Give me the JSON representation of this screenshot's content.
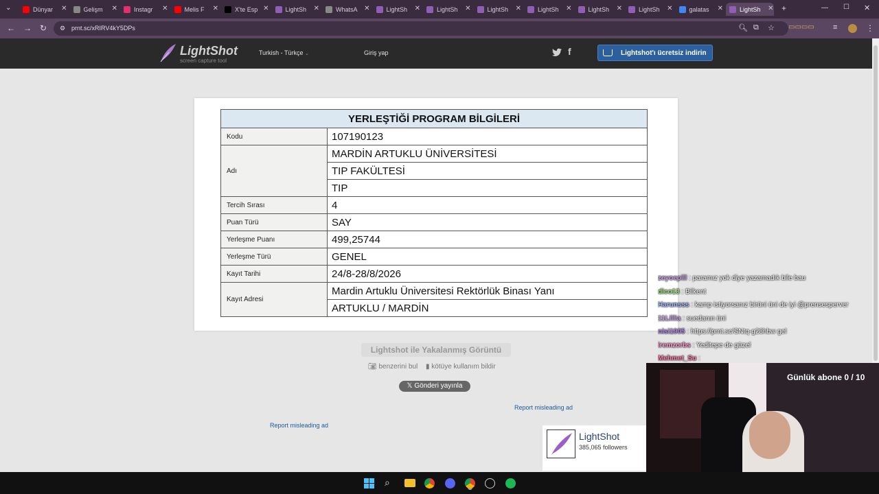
{
  "browser": {
    "tabs": [
      {
        "label": "Dünyar",
        "icon": "youtube-icon",
        "color": "#ff0000"
      },
      {
        "label": "Gelişm",
        "icon": "globe-icon",
        "color": "#888888"
      },
      {
        "label": "Instagr",
        "icon": "instagram-icon",
        "color": "#e1306c"
      },
      {
        "label": "Melis F",
        "icon": "youtube-icon",
        "color": "#ff0000"
      },
      {
        "label": "X'te Esp",
        "icon": "x-icon",
        "color": "#000000"
      },
      {
        "label": "LightSh",
        "icon": "lightshot-icon",
        "color": "#8e5fb5"
      },
      {
        "label": "WhatsA",
        "icon": "whatsapp-icon",
        "color": "#888888"
      },
      {
        "label": "LightSh",
        "icon": "lightshot-icon",
        "color": "#8e5fb5"
      },
      {
        "label": "LightSh",
        "icon": "lightshot-icon",
        "color": "#8e5fb5"
      },
      {
        "label": "LightSh",
        "icon": "lightshot-icon",
        "color": "#8e5fb5"
      },
      {
        "label": "LightSh",
        "icon": "lightshot-icon",
        "color": "#8e5fb5"
      },
      {
        "label": "LightSh",
        "icon": "lightshot-icon",
        "color": "#8e5fb5"
      },
      {
        "label": "LightSh",
        "icon": "lightshot-icon",
        "color": "#8e5fb5"
      },
      {
        "label": "galatas",
        "icon": "google-icon",
        "color": "#4285f4"
      },
      {
        "label": "LightSh",
        "icon": "lightshot-icon",
        "color": "#8e5fb5",
        "active": true
      }
    ],
    "url": "prnt.sc/xRIRV4kY5DPs"
  },
  "lightshot": {
    "logo_title": "LightShot",
    "logo_subtitle": "screen capture tool",
    "language": "Turkish - Türkçe",
    "login": "Giriş yap",
    "download_label": "Lightshot'ı ücretsiz indirin",
    "caption": "Lightshot ile Yakalanmış Görüntü",
    "find_similar": "benzerini bul",
    "report_abuse": "kötüye kullanım bildir",
    "tweet_label": "Gönderi yayınla",
    "report_ad_1": "Report misleading ad",
    "report_ad_2": "Report misleading ad",
    "ad_title": "LightShot",
    "ad_followers": "385,065 followers"
  },
  "document": {
    "heading": "YERLEŞTİĞİ PROGRAM BİLGİLERİ",
    "rows": {
      "kodu_label": "Kodu",
      "kodu": "107190123",
      "adi_label": "Adı",
      "adi_1": "MARDİN ARTUKLU ÜNİVERSİTESİ",
      "adi_2": "TIP FAKÜLTESİ",
      "adi_3": "TIP",
      "tercih_label": "Tercih Sırası",
      "tercih": "4",
      "puan_turu_label": "Puan Türü",
      "puan_turu": "SAY",
      "puan_label": "Yerleşme Puanı",
      "puan": "499,25744",
      "turu_label": "Yerleşme Türü",
      "turu": "GENEL",
      "tarih_label": "Kayıt Tarihi",
      "tarih": "24/8-28/8/2026",
      "adres_label": "Kayıt Adresi",
      "adres_1": "Mardin Artuklu Üniversitesi Rektörlük Binası Yanı",
      "adres_2": "ARTUKLU / MARDİN"
    }
  },
  "stream": {
    "chat": [
      {
        "user": "zeyoepill",
        "text": "paramız yok diye yazamadık bile bau",
        "color": "#c9a6e8"
      },
      {
        "user": "dico13",
        "text": "Bilkent",
        "color": "#9ee07a"
      },
      {
        "user": "Harunsss",
        "text": "kamp istiyorsanız birüni üni de iyi @prensesperver",
        "color": "#9fb7ff"
      },
      {
        "user": "11Lillia",
        "text": "suedanın üni",
        "color": "#c9a6e8"
      },
      {
        "user": "nisi1905",
        "text": "https://prnt.sc/SNtq-g28hbw gel",
        "color": "#b58cf0"
      },
      {
        "user": "iremzorbs",
        "text": "Yeditepe de güzel",
        "color": "#ff9ad0"
      },
      {
        "user": "Mehmet_Su",
        "text": "",
        "color": "#ff7aa8"
      }
    ],
    "subs_goal": "Günlük abone 0 / 10"
  },
  "taskbar": {
    "icons": [
      "windows-icon",
      "search-icon",
      "file-explorer-icon",
      "chrome-icon",
      "discord-icon",
      "chrome-icon",
      "clock-icon",
      "spotify-icon"
    ]
  }
}
